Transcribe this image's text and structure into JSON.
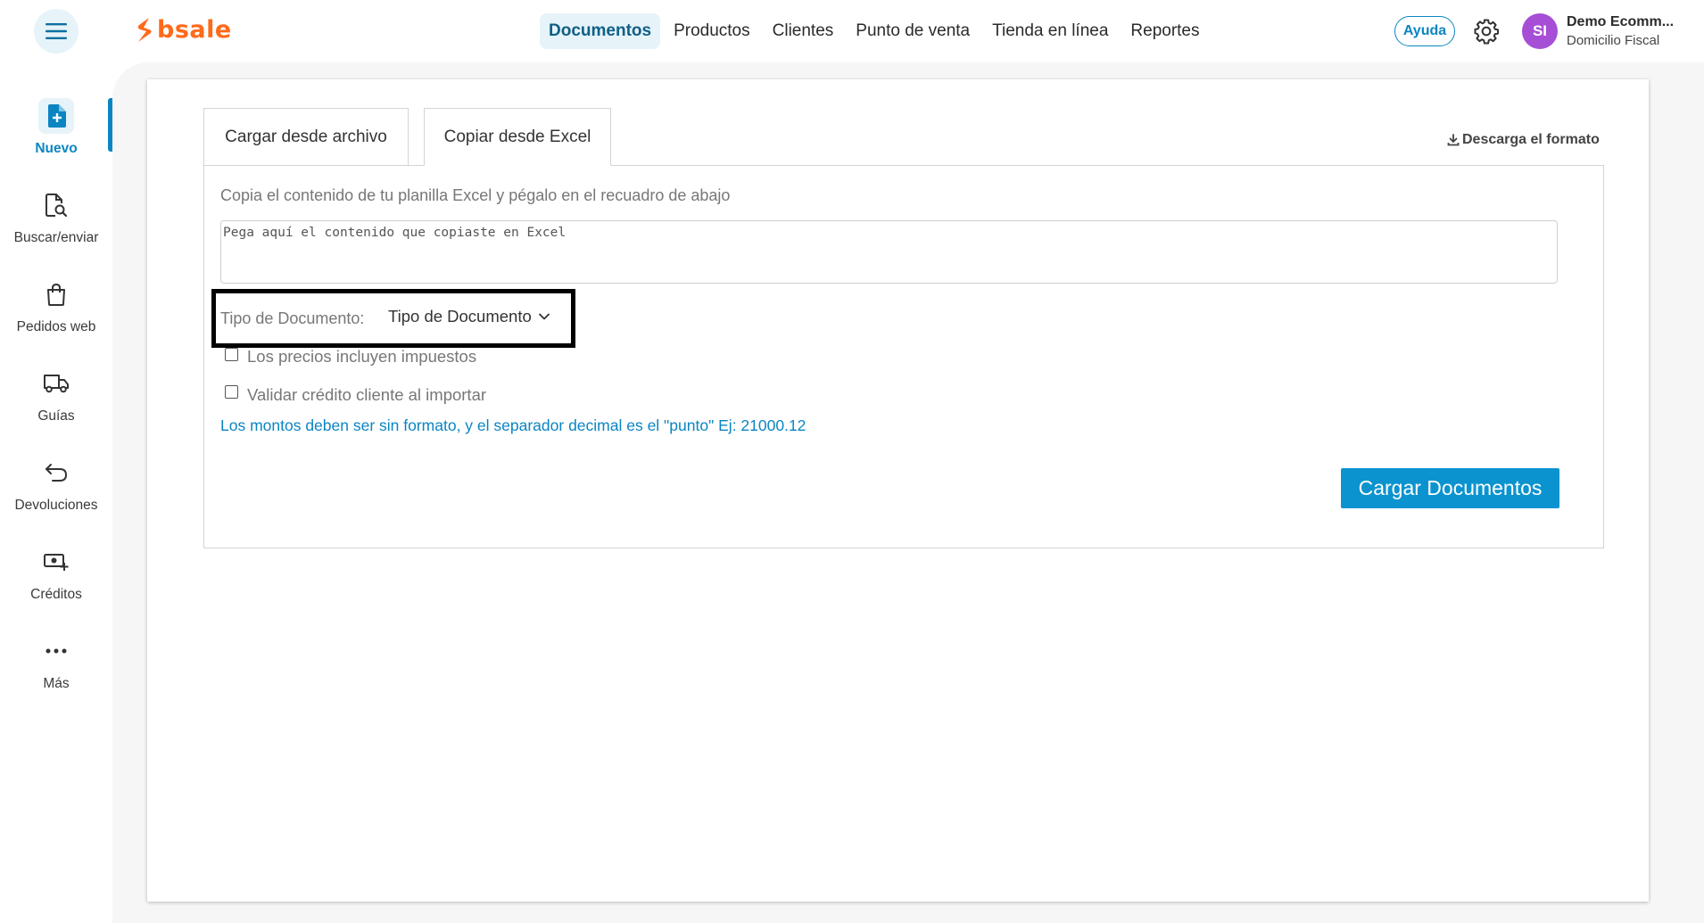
{
  "header": {
    "logo_text": "bsale",
    "nav": [
      {
        "label": "Documentos",
        "active": true
      },
      {
        "label": "Productos"
      },
      {
        "label": "Clientes"
      },
      {
        "label": "Punto de venta"
      },
      {
        "label": "Tienda en línea"
      },
      {
        "label": "Reportes"
      }
    ],
    "help_label": "Ayuda",
    "avatar_initials": "SI",
    "account_name": "Demo Ecomm...",
    "account_sub": "Domicilio Fiscal"
  },
  "sidebar": {
    "items": [
      {
        "label": "Nuevo",
        "icon": "new-document-icon",
        "active": true
      },
      {
        "label": "Buscar/enviar",
        "icon": "search-document-icon"
      },
      {
        "label": "Pedidos web",
        "icon": "shopping-bag-icon"
      },
      {
        "label": "Guías",
        "icon": "truck-icon"
      },
      {
        "label": "Devoluciones",
        "icon": "return-arrow-icon"
      },
      {
        "label": "Créditos",
        "icon": "cash-plus-icon"
      },
      {
        "label": "Más",
        "icon": "more-dots-icon"
      }
    ]
  },
  "main": {
    "tabs": [
      {
        "label": "Cargar desde archivo"
      },
      {
        "label": "Copiar desde Excel",
        "active": true
      }
    ],
    "download_label": "Descarga el formato",
    "instructions": "Copia el contenido de tu planilla Excel y pégalo en el recuadro de abajo",
    "paste_placeholder": "Pega aquí el contenido que copiaste en Excel",
    "doc_type_label": "Tipo de Documento:",
    "doc_type_value": "Tipo de Documento",
    "checkboxes": [
      {
        "label": "Los precios incluyen impuestos",
        "checked": false
      },
      {
        "label": "Validar crédito cliente al importar",
        "checked": false
      }
    ],
    "note": "Los montos deben ser sin formato, y el separador decimal es el \"punto\" Ej: 21000.12",
    "submit_label": "Cargar Documentos"
  },
  "colors": {
    "accent": "#0b85c2",
    "brand": "#ff6a1a",
    "button": "#0b93cf",
    "avatar": "#a64ed6",
    "active_bg": "#e6f3f8"
  }
}
